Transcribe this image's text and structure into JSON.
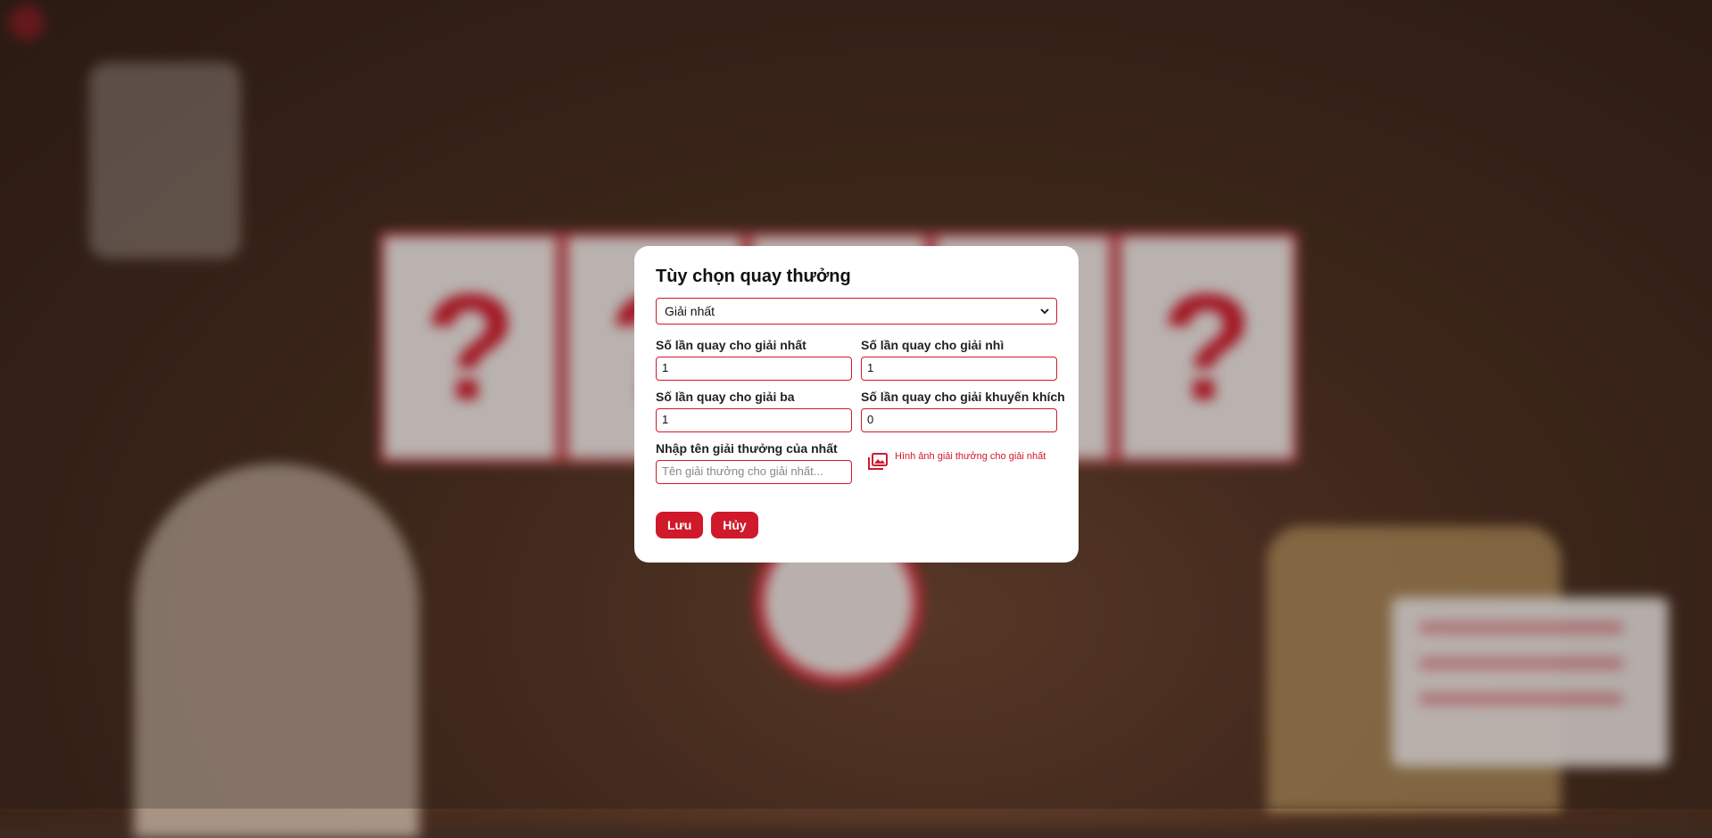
{
  "modal": {
    "title": "Tùy chọn quay thưởng",
    "prize_select": {
      "selected": "Giải nhất"
    },
    "fields": [
      {
        "label": "Số lần quay cho giải nhất",
        "value": "1"
      },
      {
        "label": "Số lần quay cho giải nhì",
        "value": "1"
      },
      {
        "label": "Số lần quay cho giải ba",
        "value": "1"
      },
      {
        "label": "Số lần quay cho giải khuyến khích",
        "value": "0"
      }
    ],
    "prize_name": {
      "label": "Nhập tên giải thưởng của nhất",
      "placeholder": "Tên giải thưởng cho giải nhất...",
      "value": ""
    },
    "image_upload_label": "Hình ảnh giải thưởng cho giải nhất",
    "save_label": "Lưu",
    "cancel_label": "Hủy"
  },
  "background": {
    "card_symbol": "?"
  },
  "colors": {
    "accent": "#d0192b",
    "modal_bg": "#ffffff",
    "backdrop": "#3e2a20"
  }
}
